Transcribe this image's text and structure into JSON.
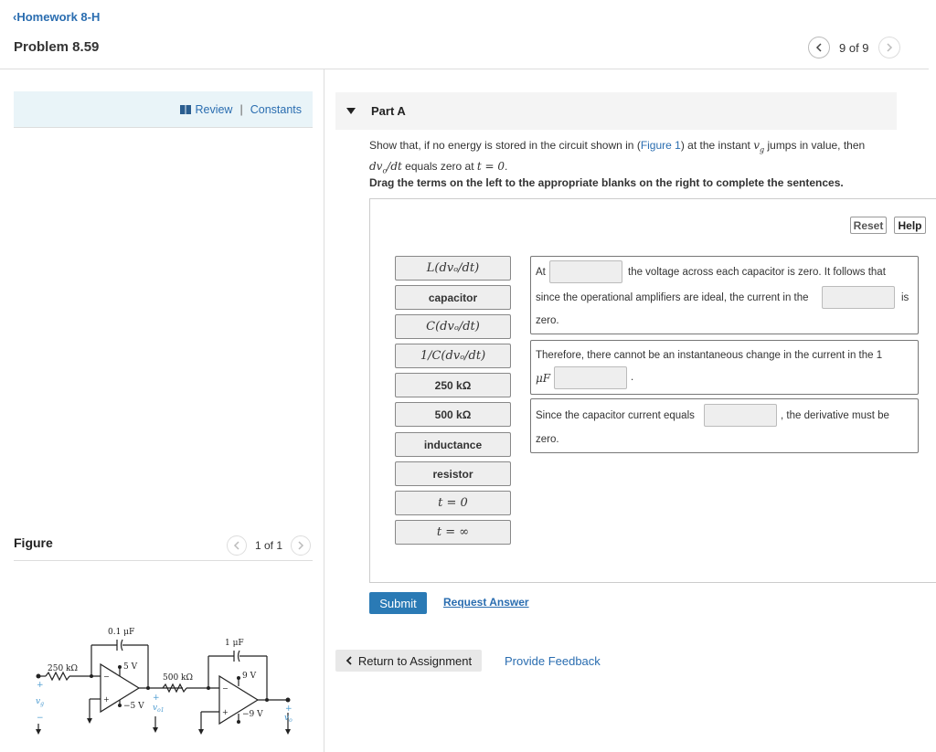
{
  "header": {
    "back_link": "Homework 8-H",
    "title": "Problem 8.59",
    "pager": "9 of 9"
  },
  "sidebar": {
    "review": "Review",
    "separator": "|",
    "constants": "Constants",
    "figure_label": "Figure",
    "figure_pager": "1 of 1"
  },
  "circuit": {
    "r1": "250 kΩ",
    "c1": "0.1 μF",
    "supply1_pos": "5 V",
    "supply1_neg": "−5 V",
    "r2": "500 kΩ",
    "c2": "1 μF",
    "supply2_pos": "9 V",
    "supply2_neg": "−9 V",
    "vg": "v",
    "vg_sub": "g",
    "vo1": "v",
    "vo1_sub": "o1",
    "vo": "v",
    "vo_sub": "o"
  },
  "part": {
    "title": "Part A",
    "q_prefix": "Show that, if no energy is stored in the circuit shown in (",
    "q_link": "Figure 1",
    "q_mid": ") at the instant ",
    "q_var": "v",
    "q_var_sub": "g",
    "q_suffix": " jumps in value, then",
    "q_line2_math": "dv",
    "q_line2_sub": "o",
    "q_line2_math2": "/dt",
    "q_line2_text": " equals zero at ",
    "q_line2_t": "t = 0",
    "q_line2_end": ".",
    "instruction": "Drag the terms on the left to the appropriate blanks on the right to complete the sentences."
  },
  "buttons": {
    "reset": "Reset",
    "help": "Help",
    "submit": "Submit",
    "request_answer": "Request Answer",
    "return": "Return to Assignment",
    "feedback": "Provide Feedback"
  },
  "terms": [
    "L(dvₒ/dt)",
    "capacitor",
    "C(dvₒ/dt)",
    "1/C(dvₒ/dt)",
    "250 kΩ",
    "500 kΩ",
    "inductance",
    "resistor",
    "t = 0",
    "t = ∞"
  ],
  "sentences": {
    "s1_at": "At",
    "s1_after": "the voltage across each capacitor is zero. It follows that",
    "s1_line2": "since the operational amplifiers are ideal, the current in the",
    "s1_is": "is",
    "s1_line3": "zero.",
    "s2_line1": "Therefore, there cannot be an instantaneous change in the current in the 1",
    "s2_unit": "μF",
    "s2_end": ".",
    "s3_before": "Since the capacitor current equals",
    "s3_after": ", the derivative must be",
    "s3_line2": "zero."
  }
}
